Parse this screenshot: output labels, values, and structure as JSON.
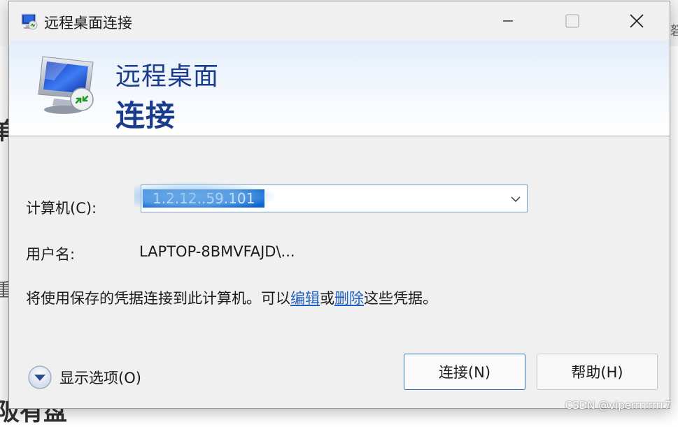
{
  "window": {
    "title": "远程桌面连接"
  },
  "banner": {
    "line1": "远程桌面",
    "line2": "连接"
  },
  "form": {
    "computer_label": "计算机(C):",
    "computer_value": "1.2.12..59.101",
    "username_label": "用户名:",
    "username_value": "LAPTOP-8BMVFAJD\\..."
  },
  "info": {
    "prefix": "将使用保存的凭据连接到此计算机。可以",
    "edit_link": "编辑",
    "middle": "或",
    "delete_link": "删除",
    "suffix": "这些凭据。"
  },
  "options": {
    "label": "显示选项(O)"
  },
  "buttons": {
    "connect": "连接(N)",
    "help": "帮助(H)"
  },
  "watermark": "CSDN @viperrrrrrrr7",
  "background_fragments": {
    "top_right": "砮",
    "left_mid": "单",
    "left_low": "重",
    "bottom": "阪有盘"
  },
  "colors": {
    "accent": "#1b3c8c",
    "link": "#1f5fbf",
    "selection": "#0a64d2",
    "focus_border": "#2c6dbd"
  },
  "icons": [
    "rdp-app-icon",
    "minimize-icon",
    "maximize-icon",
    "close-icon",
    "rdp-monitor-icon",
    "chevron-down-icon",
    "expand-options-icon"
  ]
}
